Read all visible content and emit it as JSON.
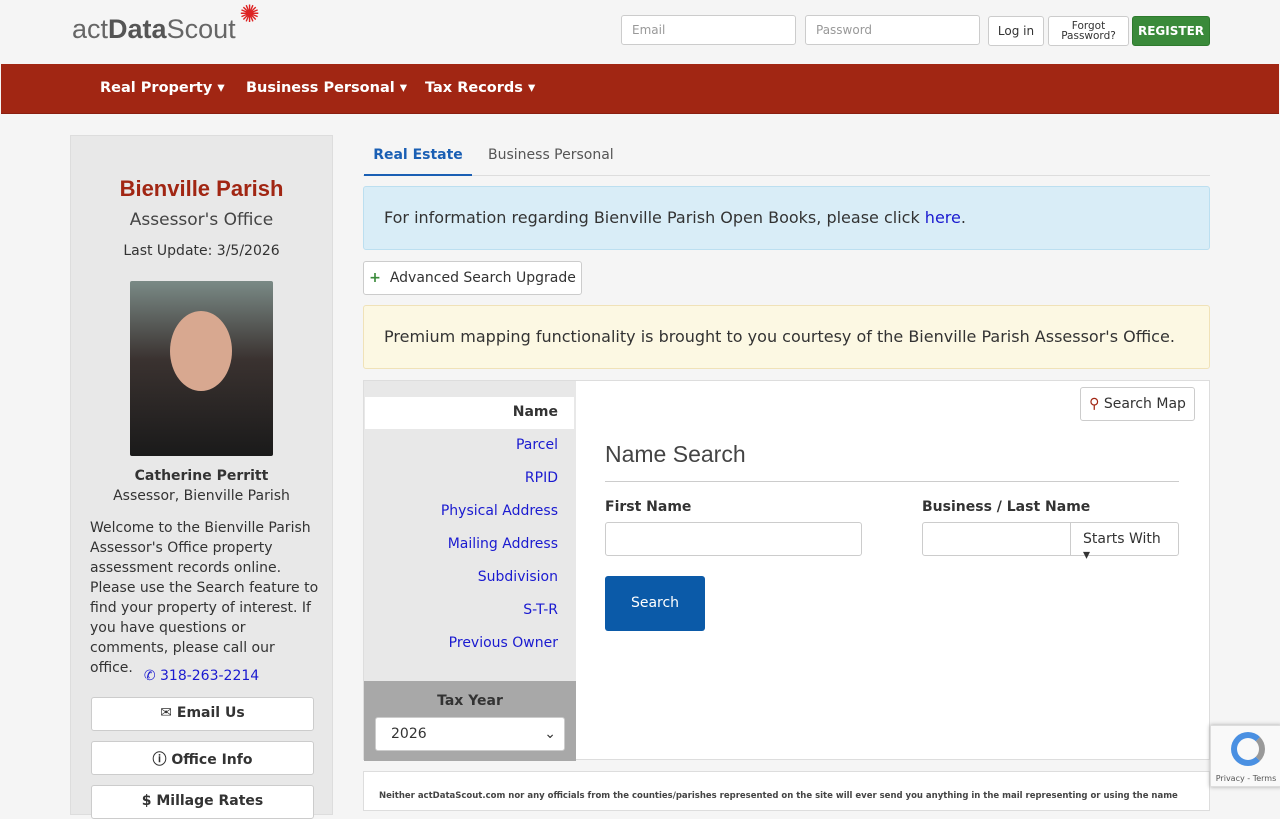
{
  "header": {
    "logo": "actDataScout",
    "email_placeholder": "Email",
    "password_placeholder": "Password",
    "login": "Log in",
    "forgot": "Forgot Password?",
    "register": "REGISTER"
  },
  "nav": [
    "Real Property",
    "Business Personal",
    "Tax Records"
  ],
  "sidebar": {
    "title": "Bienville Parish",
    "subtitle": "Assessor's Office",
    "last_update": "Last Update: 3/5/2026",
    "name": "Catherine Perritt",
    "role": "Assessor, Bienville Parish",
    "welcome": "Welcome to the Bienville Parish Assessor's Office property assessment records online. Please use the Search feature to find your property of interest. If you have questions or comments, please call our office.",
    "phone": "318-263-2214",
    "email_btn": "Email Us",
    "office_btn": "Office Info",
    "millage_btn": "$ Millage Rates"
  },
  "tabs": [
    "Real Estate",
    "Business Personal"
  ],
  "info_alert": {
    "text": "For information regarding Bienville Parish Open Books, please click ",
    "link": "here",
    "end": "."
  },
  "advanced": "Advanced Search Upgrade",
  "premium": "Premium mapping functionality is brought to you courtesy of the Bienville Parish Assessor's Office.",
  "search_menu": [
    "Name",
    "Parcel",
    "RPID",
    "Physical Address",
    "Mailing Address",
    "Subdivision",
    "S-T-R",
    "Previous Owner"
  ],
  "tax_year": {
    "label": "Tax Year",
    "value": "2026"
  },
  "search_map": "Search Map",
  "name_search": {
    "title": "Name Search",
    "first": "First Name",
    "last": "Business / Last Name",
    "mode": "Starts With",
    "button": "Search"
  },
  "disclaimer": "Neither actDataScout.com nor any officials from the counties/parishes represented on the site will ever send you anything in the mail representing or using the name",
  "recaptcha": "Privacy - Terms"
}
